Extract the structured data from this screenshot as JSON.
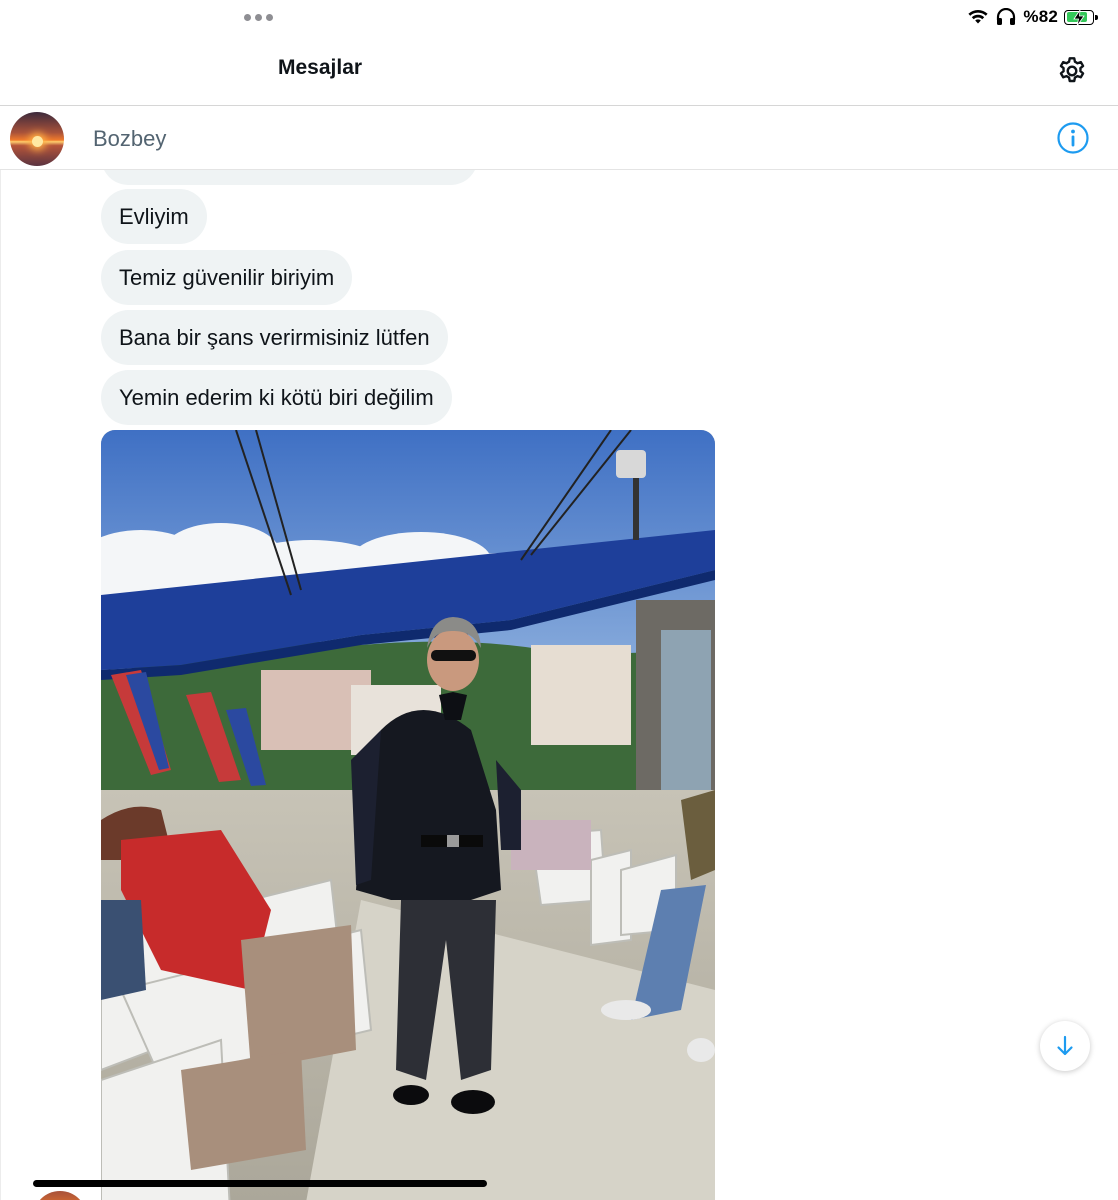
{
  "status_bar": {
    "battery_percent": "%82",
    "battery_level": 0.82,
    "icons": [
      "wifi-icon",
      "headphones-icon",
      "battery-charging-icon"
    ]
  },
  "header": {
    "title": "Mesajlar",
    "settings_icon": "gear-icon"
  },
  "conversation": {
    "contact_name": "Bozbey",
    "info_icon": "info-icon"
  },
  "messages": [
    {
      "text": "Evliyim"
    },
    {
      "text": "Temiz güvenilir biriyim"
    },
    {
      "text": "Bana bir şans verirmisiniz lütfen"
    },
    {
      "text": "Yemin ederim ki kötü biri değilim"
    }
  ],
  "scroll_button": {
    "icon": "arrow-down-icon"
  },
  "colors": {
    "accent": "#1d9bf0",
    "bubble_bg": "#eff3f4",
    "secondary_text": "#536471",
    "text": "#0f1419"
  }
}
